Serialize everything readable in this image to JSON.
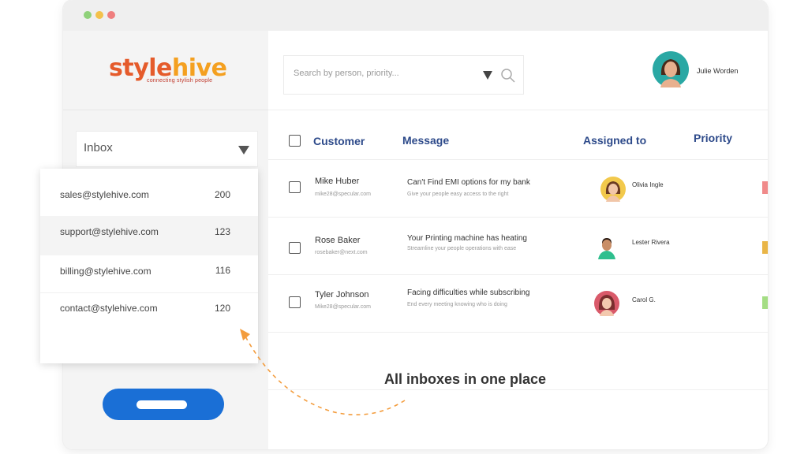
{
  "brand": {
    "logo_style": "style",
    "logo_hive": "hive",
    "tagline": "connecting stylish people",
    "colors": {
      "style": "#e55b2b",
      "hive": "#f4a020",
      "accent": "#1a6fd6",
      "heading": "#2d4a8a"
    }
  },
  "window": {
    "dots": [
      {
        "name": "green",
        "color": "#8fd17a"
      },
      {
        "name": "yellow",
        "color": "#f3c14b"
      },
      {
        "name": "red",
        "color": "#ef7e7e"
      }
    ]
  },
  "sidebar": {
    "inbox_label": "Inbox",
    "dropdown": [
      {
        "email": "sales@stylehive.com",
        "count": "200"
      },
      {
        "email": "support@stylehive.com",
        "count": "123"
      },
      {
        "email": "billing@stylehive.com",
        "count": "116"
      },
      {
        "email": "contact@stylehive.com",
        "count": "120"
      }
    ]
  },
  "search": {
    "placeholder": "Search by person, priority..."
  },
  "user": {
    "name": "Julie Worden"
  },
  "table": {
    "headers": {
      "customer": "Customer",
      "message": "Message",
      "assigned": "Assigned to",
      "priority": "Priority"
    },
    "rows": [
      {
        "name": "Mike Huber",
        "email": "mike28@specular.com",
        "message": "Can't Find EMI options for my bank",
        "sub": "Give your people easy access to the right",
        "assignee": "Olivia Ingle",
        "priority_color": "#f08a8a"
      },
      {
        "name": "Rose Baker",
        "email": "rosebaker@next.com",
        "message": "Your Printing machine has heating",
        "sub": "Streamline your people operations with ease",
        "assignee": "Lester Rivera",
        "priority_color": "#e9b547"
      },
      {
        "name": "Tyler Johnson",
        "email": "Mike28@specular.com",
        "message": "Facing difficulties while subscribing",
        "sub": "End every meeting knowing who is doing",
        "assignee": "Carol G.",
        "priority_color": "#a4dd84"
      }
    ]
  },
  "annotation": "All inboxes in one place"
}
